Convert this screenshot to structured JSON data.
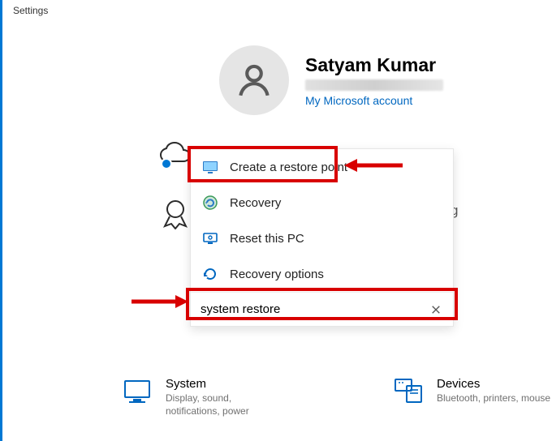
{
  "window_title": "Settings",
  "profile": {
    "name": "Satyam Kumar",
    "link": "My Microsoft account"
  },
  "search": {
    "value": "system restore",
    "results": [
      {
        "label": "Create a restore point",
        "icon": "monitor-check-icon"
      },
      {
        "label": "Recovery",
        "icon": "recovery-disc-icon"
      },
      {
        "label": "Reset this PC",
        "icon": "reset-pc-icon"
      },
      {
        "label": "Recovery options",
        "icon": "recovery-options-icon"
      }
    ]
  },
  "categories": {
    "system": {
      "title": "System",
      "desc": "Display, sound, notifications, power"
    },
    "devices": {
      "title": "Devices",
      "desc": "Bluetooth, printers, mouse"
    }
  }
}
